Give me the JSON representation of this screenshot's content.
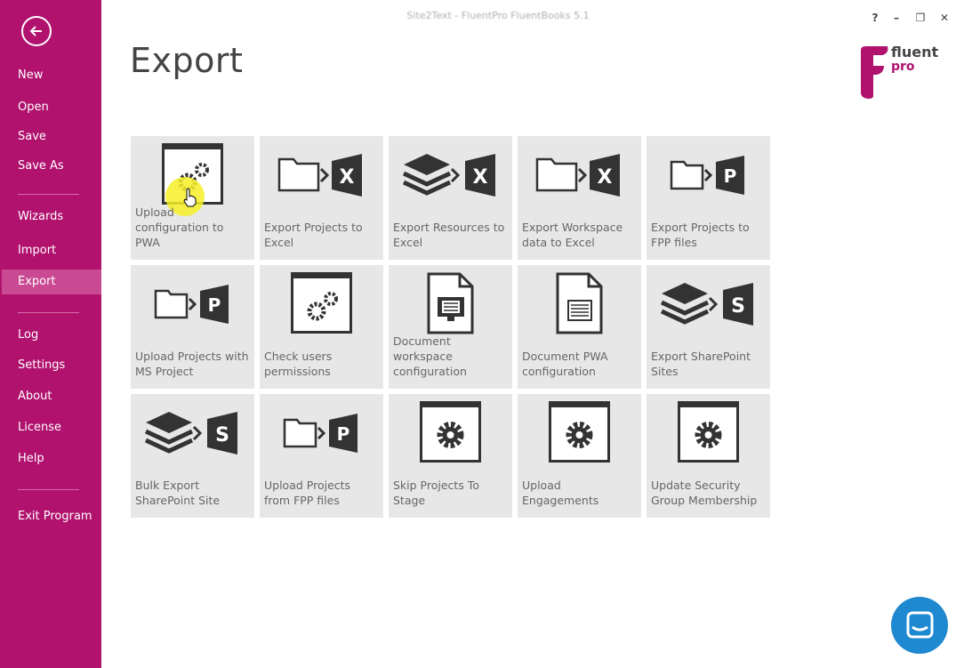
{
  "window": {
    "title": "Site2Text - FluentPro FluentBooks 5.1"
  },
  "window_controls": {
    "help": "?",
    "minimize": "–",
    "restore": "❐",
    "close": "✕"
  },
  "sidebar": {
    "items": [
      {
        "label": "New"
      },
      {
        "label": "Open"
      },
      {
        "label": "Save"
      },
      {
        "label": "Save As"
      },
      {
        "label": "Wizards"
      },
      {
        "label": "Import"
      },
      {
        "label": "Export"
      },
      {
        "label": "Log"
      },
      {
        "label": "Settings"
      },
      {
        "label": "About"
      },
      {
        "label": "License"
      },
      {
        "label": "Help"
      },
      {
        "label": "Exit Program"
      }
    ],
    "active": "Export"
  },
  "page": {
    "title": "Export"
  },
  "logo": {
    "line1": "fluent",
    "line2": "pro"
  },
  "tiles": [
    {
      "label": "Upload configuration to PWA",
      "icon": "window-gears-icon"
    },
    {
      "label": "Export Projects to Excel",
      "icon": "folder-to-excel-icon"
    },
    {
      "label": "Export Resources to Excel",
      "icon": "layers-to-excel-icon"
    },
    {
      "label": "Export Workspace data to Excel",
      "icon": "folder-to-excel-icon"
    },
    {
      "label": "Export Projects to FPP files",
      "icon": "folder-to-project-icon"
    },
    {
      "label": "Upload Projects with MS Project",
      "icon": "folder-to-project-icon"
    },
    {
      "label": "Check users permissions",
      "icon": "window-gears-icon"
    },
    {
      "label": "Document workspace configuration",
      "icon": "document-monitor-icon"
    },
    {
      "label": "Document PWA configuration",
      "icon": "document-list-icon"
    },
    {
      "label": "Export SharePoint Sites",
      "icon": "layers-to-sharepoint-icon"
    },
    {
      "label": "Bulk Export SharePoint Site",
      "icon": "layers-to-sharepoint-icon"
    },
    {
      "label": "Upload Projects from FPP files",
      "icon": "folder-to-project-icon"
    },
    {
      "label": "Skip Projects To Stage",
      "icon": "window-gear-icon"
    },
    {
      "label": "Upload Engagements",
      "icon": "window-gear-icon"
    },
    {
      "label": "Update Security Group Membership",
      "icon": "window-gear-icon"
    }
  ],
  "colors": {
    "sidebar": "#b0126e",
    "sidebar_active": "#c94a93",
    "tile": "#e7e7e7",
    "icon": "#333333",
    "chat": "#1e88d0"
  }
}
